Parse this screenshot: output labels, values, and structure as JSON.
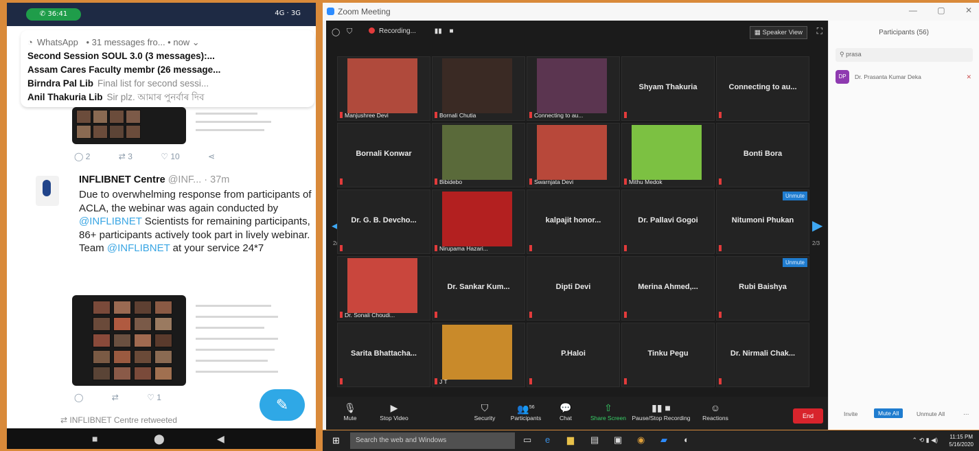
{
  "phone": {
    "call_time": "36:41",
    "status_right": "4G · 3G",
    "notification": {
      "app": "WhatsApp",
      "summary": "• 31 messages fro... • now ⌄",
      "lines": [
        {
          "title": "Second Session SOUL 3.0 (3 messages):...",
          "sub": ""
        },
        {
          "title": "Assam Cares Faculty membr (26 message...",
          "sub": ""
        },
        {
          "title": "Birndra Pal Lib",
          "sub": "Final list for second sessi..."
        },
        {
          "title": "Anil Thakuria Lib",
          "sub": "Sir plz. আমাৰ পুনৰ্বাৰ দিব"
        }
      ]
    },
    "tweet1_actions": [
      "2",
      "3",
      "10"
    ],
    "tweet": {
      "name": "INFLIBNET Centre",
      "handle": "@INF... · 37m",
      "text_1": "Due to overwhelming response from participants of ACLA, the webinar was again conducted by ",
      "mention_1": "@INFLIBNET",
      "text_2": " Scientists for remaining participants, 86+ participants actively took part in lively webinar. Team ",
      "mention_2": "@INFLIBNET",
      "text_3": " at your service 24*7"
    },
    "tweet2_actions": [
      "",
      "",
      "1"
    ],
    "retweet_label": "INFLIBNET Centre retweeted"
  },
  "zoom": {
    "window_title": "Zoom Meeting",
    "recording_label": "Recording...",
    "speaker_view_label": "Speaker View",
    "page_label": "2/3",
    "unmute_label": "Unmute",
    "participants": [
      {
        "name": "Manjushree Devi",
        "video": true,
        "color": "#b04a3c"
      },
      {
        "name": "Bornali Chutia",
        "video": true,
        "color": "#3a2a24"
      },
      {
        "name": "Connecting to au...",
        "video": true,
        "color": "#5b3550"
      },
      {
        "name": "Shyam Thakuria",
        "video": false
      },
      {
        "name": "Connecting to au...",
        "video": false
      },
      {
        "name": "Bornali Konwar",
        "video": false
      },
      {
        "name": "Bibidebo",
        "video": true,
        "color": "#5a6a3a"
      },
      {
        "name": "Swarnjata Devi",
        "video": true,
        "color": "#b8483a"
      },
      {
        "name": "Mithu Medok",
        "video": true,
        "color": "#7cc142"
      },
      {
        "name": "Bonti Bora",
        "video": false
      },
      {
        "name": "Dr. G. B. Devcho...",
        "video": false
      },
      {
        "name": "Nirupama Hazari...",
        "video": true,
        "color": "#b32020"
      },
      {
        "name": "kalpajit  honor...",
        "video": false
      },
      {
        "name": "Dr. Pallavi Gogoi",
        "video": false
      },
      {
        "name": "Nitumoni Phukan",
        "video": false,
        "unmute": true
      },
      {
        "name": "Dr. Sonali Choudi...",
        "video": true,
        "color": "#c9463d"
      },
      {
        "name": "Dr. Sankar Kum...",
        "video": false
      },
      {
        "name": "Dipti Devi",
        "video": false
      },
      {
        "name": "Merina  Ahmed,...",
        "video": false
      },
      {
        "name": "Rubi Baishya",
        "video": false,
        "unmute": true
      },
      {
        "name": "Sarita  Bhattacha...",
        "video": false
      },
      {
        "name": "J T",
        "video": true,
        "color": "#c98a2a"
      },
      {
        "name": "P.Haloi",
        "video": false
      },
      {
        "name": "Tinku Pegu",
        "video": false
      },
      {
        "name": "Dr. Nirmali Chak...",
        "video": false
      }
    ],
    "toolbar": {
      "mute": "Mute",
      "stop_video": "Stop Video",
      "security": "Security",
      "participants": "Participants",
      "participants_count": "56",
      "chat": "Chat",
      "share_screen": "Share Screen",
      "record": "Pause/Stop Recording",
      "reactions": "Reactions",
      "end": "End"
    },
    "panel": {
      "title": "Participants (56)",
      "search_value": "prasa",
      "result_initials": "DP",
      "result_name": "Dr. Prasanta Kumar Deka",
      "invite": "Invite",
      "mute_all": "Mute All",
      "unmute_all": "Unmute All"
    }
  },
  "taskbar": {
    "search_placeholder": "Search the web and Windows",
    "time": "11:15 PM",
    "date": "5/16/2020"
  }
}
